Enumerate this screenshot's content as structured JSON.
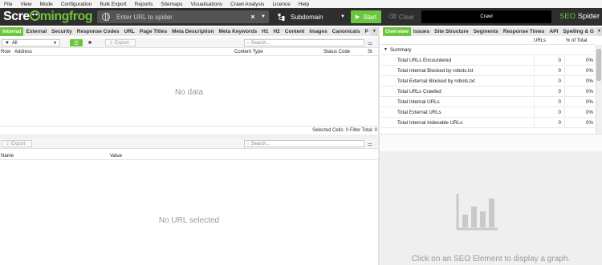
{
  "menu": [
    "File",
    "View",
    "Mode",
    "Configuration",
    "Bulk Export",
    "Reports",
    "Sitemaps",
    "Visualisations",
    "Crawl Analysis",
    "Licence",
    "Help"
  ],
  "logo": {
    "part1": "Scre",
    "part2": "mingfrog"
  },
  "url_bar": {
    "placeholder": "Enter URL to spider",
    "clear": "×",
    "dropdown": "▼"
  },
  "mode": {
    "label": "Subdomain"
  },
  "buttons": {
    "start": "Start",
    "clear": "Clear"
  },
  "crawl_status": "Crawl",
  "brand": {
    "seo": "SEO",
    "spider": "Spider"
  },
  "left_tabs": [
    "Internal",
    "External",
    "Security",
    "Response Codes",
    "URL",
    "Page Titles",
    "Meta Description",
    "Meta Keywords",
    "H1",
    "H2",
    "Content",
    "Images",
    "Canonicals",
    "P"
  ],
  "right_tabs": [
    "Overview",
    "Issues",
    "Site Structure",
    "Segments",
    "Response Times",
    "API",
    "Spelling & G"
  ],
  "filter": {
    "selected": "All"
  },
  "export_label": "Export",
  "search_placeholder": "Search...",
  "upper_columns": {
    "row": "Row",
    "address": "Address",
    "content_type": "Content Type",
    "status_code": "Status Code",
    "st": "St"
  },
  "upper_empty": "No data",
  "status_line": "Selected Cells:  0  Filter Total:  0",
  "lower_columns": {
    "name": "Name",
    "value": "Value"
  },
  "lower_empty": "No URL selected",
  "overview": {
    "col_urls": "URLs",
    "col_pct": "% of Total",
    "summary_label": "Summary",
    "rows": [
      {
        "label": "Total URLs Encountered",
        "urls": "0",
        "pct": "0%"
      },
      {
        "label": "Total Internal Blocked by robots.txt",
        "urls": "0",
        "pct": "0%"
      },
      {
        "label": "Total External Blocked by robots.txt",
        "urls": "0",
        "pct": "0%"
      },
      {
        "label": "Total URLs Crawled",
        "urls": "0",
        "pct": "0%"
      },
      {
        "label": "Total Internal URLs",
        "urls": "0",
        "pct": "0%"
      },
      {
        "label": "Total External URLs",
        "urls": "0",
        "pct": "0%"
      },
      {
        "label": "Total Internal Indexable URLs",
        "urls": "0",
        "pct": "0%"
      }
    ]
  },
  "graph_message": "Click on an SEO Element to display a graph.",
  "colors": {
    "accent": "#6cc63d",
    "toolbar": "#2e2e2e"
  }
}
